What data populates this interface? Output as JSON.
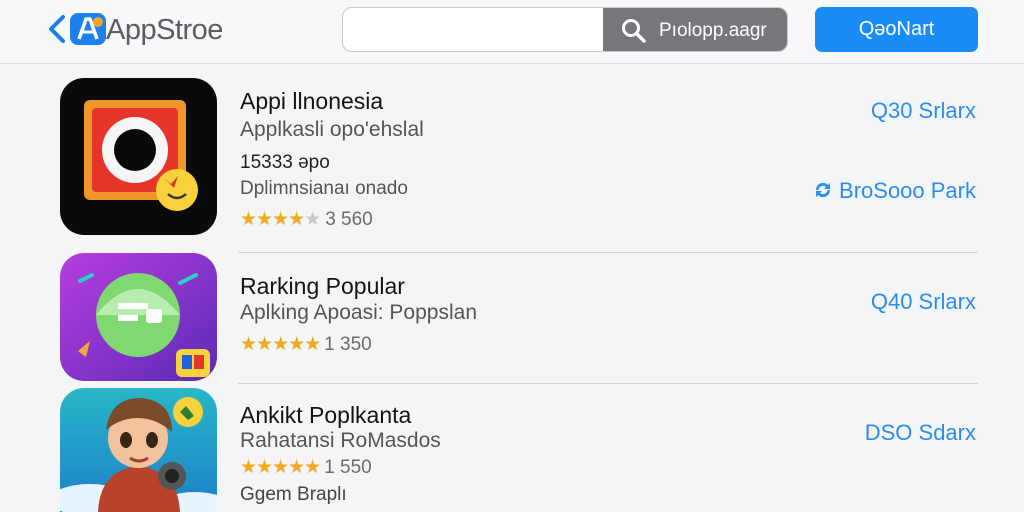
{
  "header": {
    "app_name": "AppStroe",
    "search_placeholder": "",
    "search_button_label": "Pıolopp.aagr",
    "primary_button_label": "QəoNart",
    "back_icon": "chevron-left-icon",
    "logo_icon": "app-store-logo-icon",
    "search_icon": "search-icon"
  },
  "apps": [
    {
      "title": "Appi llnonesia",
      "subtitle": "Applkasli opo'ehslal",
      "meta1": "15333 əpo",
      "meta2": "Dplimnsianaı onado",
      "stars": "★★★★★",
      "rating_count": "3 560",
      "action": "Q30 Srlarx",
      "secondary_action": "BroSooo Park",
      "secondary_action_icon": "refresh-icon"
    },
    {
      "title": "Rarking Popular",
      "subtitle": "Aplking Apoasi: Poppslan",
      "stars": "★★★★★",
      "rating_count": "1 350",
      "action": "Q40 Srlarx"
    },
    {
      "title": "Ankikt Poplkanta",
      "subtitle": "Rahatansi RoMasdos",
      "meta": "Ggem Braplı",
      "stars": "★★★★★",
      "rating_count": "1 550",
      "action": "DSO Sdarx"
    }
  ],
  "colors": {
    "accent": "#1a8cf5",
    "link": "#2a8ef0",
    "star": "#f4a81d",
    "search_button": "#76777b"
  }
}
